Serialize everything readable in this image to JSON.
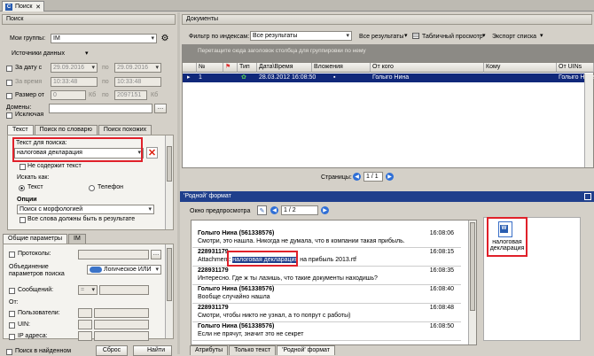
{
  "window": {
    "tab_label": "Поиск",
    "close": "✕"
  },
  "left": {
    "section_title": "Поиск",
    "group_label": "Мои группы:",
    "group_value": "IM",
    "sources_label": "Источники данных",
    "date_label": "За дату с",
    "date_from": "29.09.2016",
    "date_to_label": "по",
    "date_to": "29.09.2016",
    "time_label": "За время",
    "time_from": "10:33:48",
    "time_to": "10:33:48",
    "size_label": "Размер от",
    "size_from": "0",
    "size_unit": "Кб",
    "size_to": "2097151",
    "size_unit2": "Кб",
    "domains_label": "Домены:",
    "exclude_label": "Исключая",
    "tabs": [
      "Текст",
      "Поиск по словарю",
      "Поиск похожих"
    ],
    "search_text_label": "Текст для поиска:",
    "search_text_value": "налоговая декларация",
    "not_contains_label": "Не содержит текст",
    "search_how_label": "Искать как:",
    "radio_text": "Текст",
    "radio_phone": "Телефон",
    "options_label": "Опции",
    "options_value": "Поиск с морфологией",
    "all_words_label": "Все слова должны быть в результате",
    "bottom_tabs": [
      "Общие параметры",
      "IM"
    ],
    "protocols_label": "Протоколы:",
    "combine_label": "Объединение параметров поиска",
    "combine_value": "Логическое ИЛИ",
    "messages_label": "Сообщений:",
    "messages_value": "=",
    "from_label": "От:",
    "users_label": "Пользователи:",
    "uin_label": "UIN:",
    "ip_label": "IP адреса:",
    "search_found_label": "Поиск в найденном",
    "reset_label": "Сброс",
    "find_label": "Найти"
  },
  "docs": {
    "title": "Документы",
    "filter_label": "Фильтр по индексам:",
    "filter_value": "Все результаты",
    "results_btn": "Все результаты",
    "view_btn": "Табличный просмотр",
    "export_btn": "Экспорт списка",
    "group_hint": "Перетащите сюда заголовок столбца для группировки по нему",
    "columns": [
      "№",
      "",
      "Тип",
      "Дата\\Время",
      "Вложения",
      "От кого",
      "Кому",
      "От UINs"
    ],
    "row": {
      "num": "1",
      "date": "28.03.2012 16:08:50",
      "attach": "",
      "from": "Голыго Нина",
      "to": "",
      "from_uin": "Голыго Нина"
    },
    "pages_label": "Страницы:",
    "page_value": "1 / 1"
  },
  "preview": {
    "title": "'Родной' формат",
    "window_label": "Окно предпросмотра",
    "page_value": "1 / 2",
    "messages": [
      {
        "name": "Голыго Нина (561338576)",
        "time": "16:08:06",
        "text": "Смотри, это нашла. Никогда не думала, что в компании такая прибыль."
      },
      {
        "name": "228931179",
        "time": "16:08:15",
        "text_pre": "Attachment: ",
        "text_hl": "налоговая декларация",
        "text_post": " на прибыль 2013.rtf"
      },
      {
        "name": "228931179",
        "time": "16:08:35",
        "text": "Интересно. Где ж ты лазишь, что такие документы находишь?"
      },
      {
        "name": "Голыго Нина (561338576)",
        "time": "16:08:40",
        "text": "Вообще случайно нашла"
      },
      {
        "name": "228931179",
        "time": "16:08:48",
        "text": "Смотри, чтобы никто не узнал, а то попрут с работы)"
      },
      {
        "name": "Голыго Нина (561338576)",
        "time": "16:08:50",
        "text": "Если не прячут, значит это не секрет"
      }
    ],
    "attachment_label": "налоговая декларация",
    "bottom_tabs": [
      "Атрибуты",
      "Только текст",
      "'Родной' формат"
    ]
  }
}
